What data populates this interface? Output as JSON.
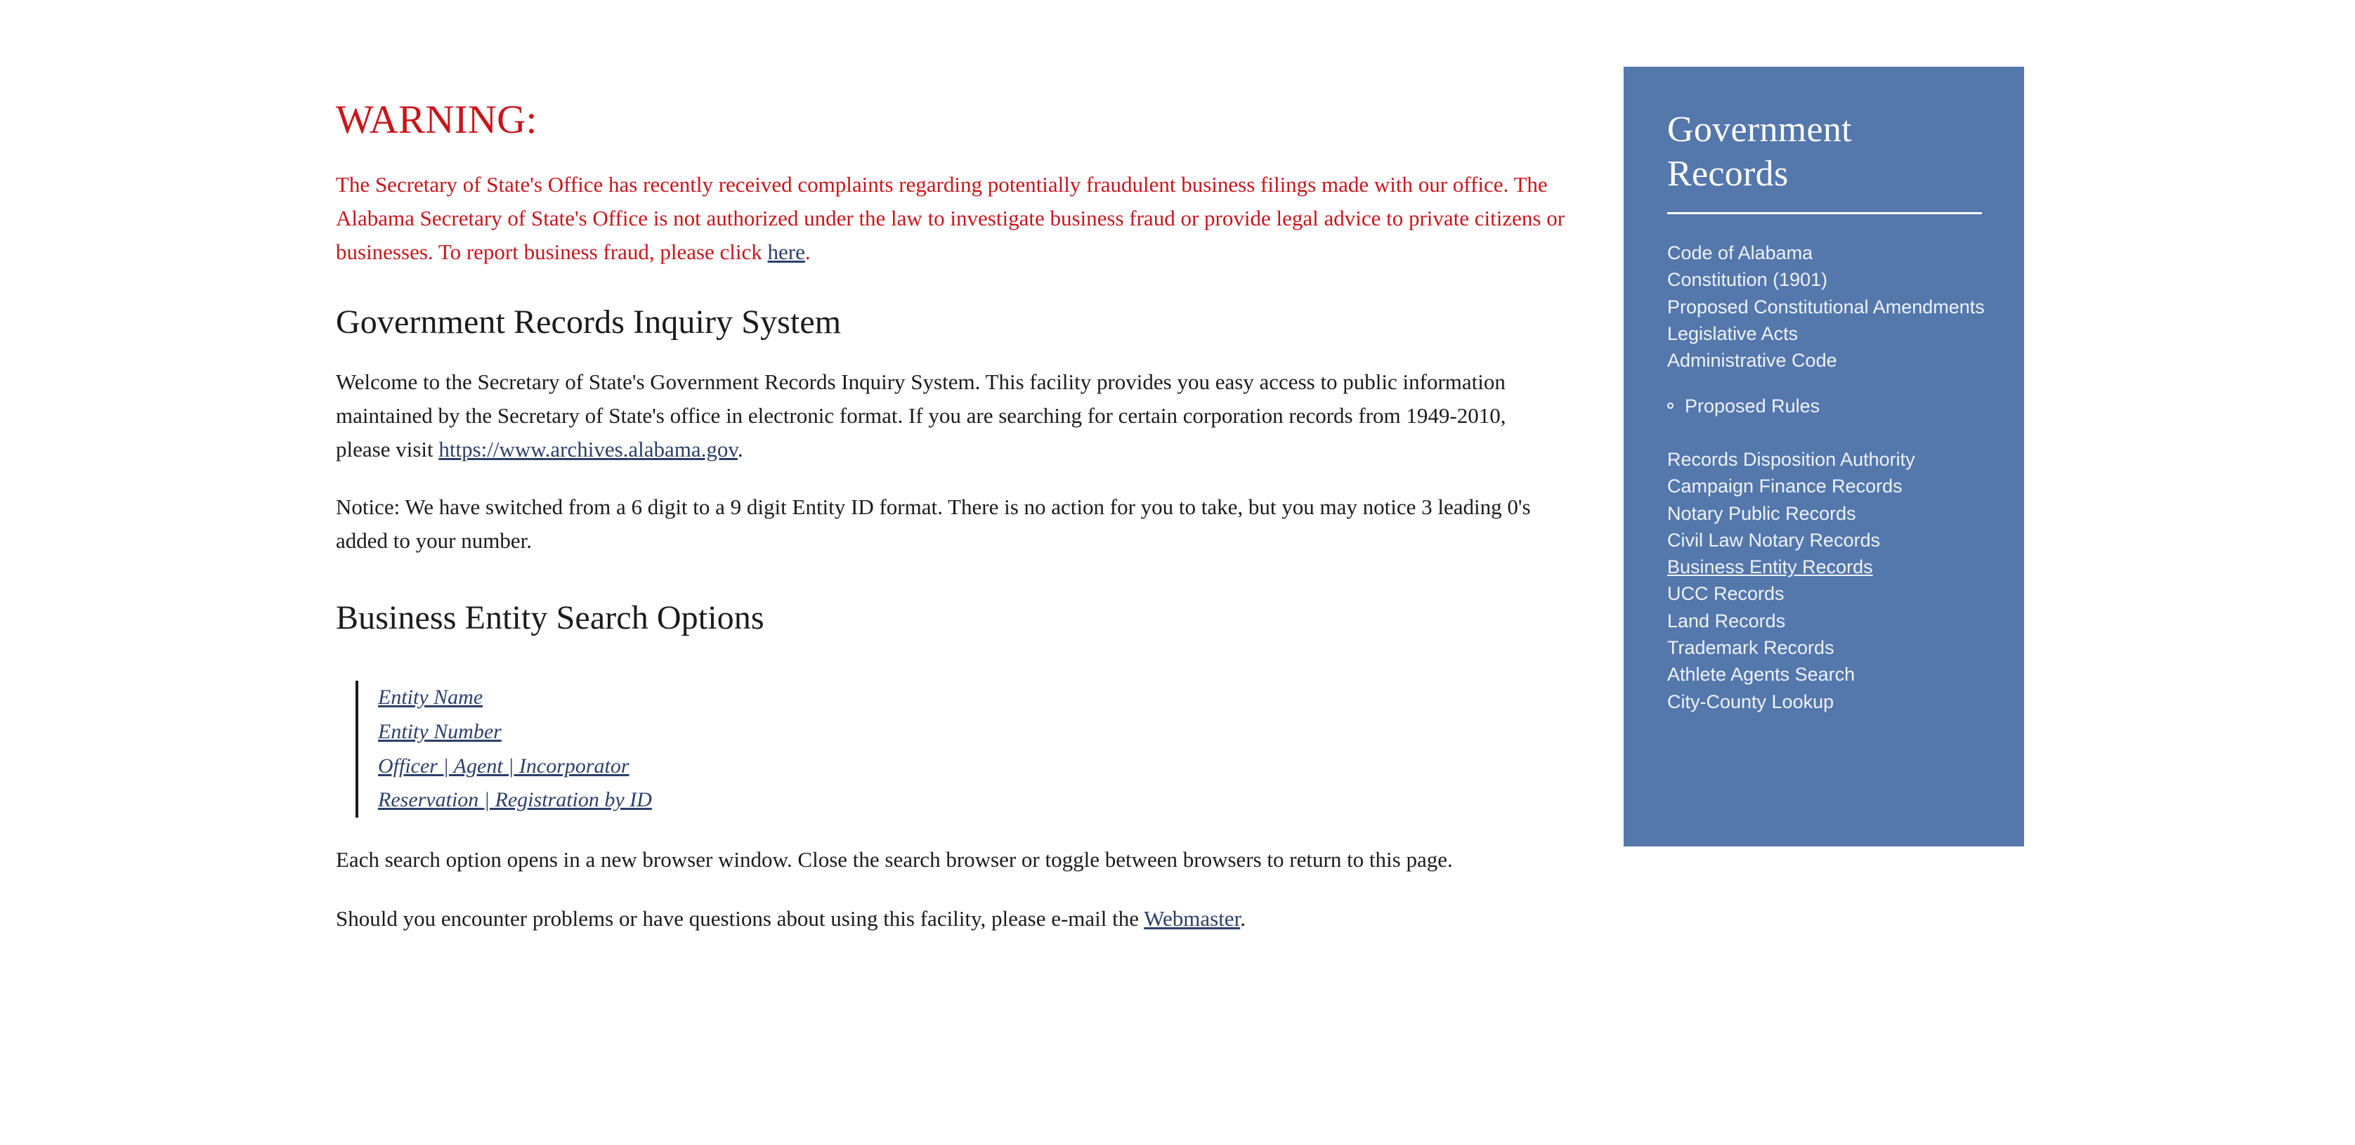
{
  "colors": {
    "warning_red": "#c9151b",
    "link_blue": "#2b3f6b",
    "sidebar_blue": "#5477ac",
    "sidebar_text": "#eef3fa",
    "body_text": "#1b1b1b"
  },
  "main": {
    "warning_heading": "WARNING:",
    "warning_body": {
      "text_before": "The Secretary of State's Office has recently received complaints regarding potentially fraudulent business filings made with our office. The Alabama Secretary of State's Office is not authorized under the law to investigate business fraud or provide legal advice to private citizens or businesses. To report business fraud, please click ",
      "link_text": "here",
      "text_after": "."
    },
    "heading_inquiry": "Government Records Inquiry System",
    "par_welcome": {
      "text_before": "Welcome to the Secretary of State's Government Records Inquiry System. This facility provides you easy access to public information maintained by the Secretary of State's office in electronic format. If you are searching for certain corporation records from 1949-2010, please visit ",
      "link_text": "https://www.archives.alabama.gov",
      "text_after": "."
    },
    "par_notice": "Notice: We have switched from a 6 digit to a 9 digit Entity ID format. There is no action for you to take, but you may notice 3 leading 0's added to your number.",
    "heading_search": "Business Entity Search Options",
    "search_options": [
      "Entity Name",
      "Entity Number",
      "Officer | Agent | Incorporator",
      "Reservation | Registration by ID"
    ],
    "par_each": "Each search option opens in a new browser window. Close the search browser or toggle between browsers to return to this page.",
    "par_problems": {
      "text_before": "Should you encounter problems or have questions about using this facility, please e-mail the ",
      "link_text": "Webmaster",
      "text_after": "."
    }
  },
  "sidebar": {
    "title": "Government Records",
    "group_primary": [
      "Code of Alabama",
      "Constitution (1901)",
      "Proposed Constitutional Amendments",
      "Legislative Acts",
      "Administrative Code"
    ],
    "group_rules": [
      "Proposed Rules"
    ],
    "group_records": [
      "Records Disposition Authority",
      "Campaign Finance Records",
      "Notary Public Records",
      "Civil Law Notary Records",
      "Business Entity Records",
      "UCC Records",
      "Land Records",
      "Trademark Records",
      "Athlete Agents Search",
      "City-County Lookup"
    ],
    "current_item": "Business Entity Records"
  }
}
